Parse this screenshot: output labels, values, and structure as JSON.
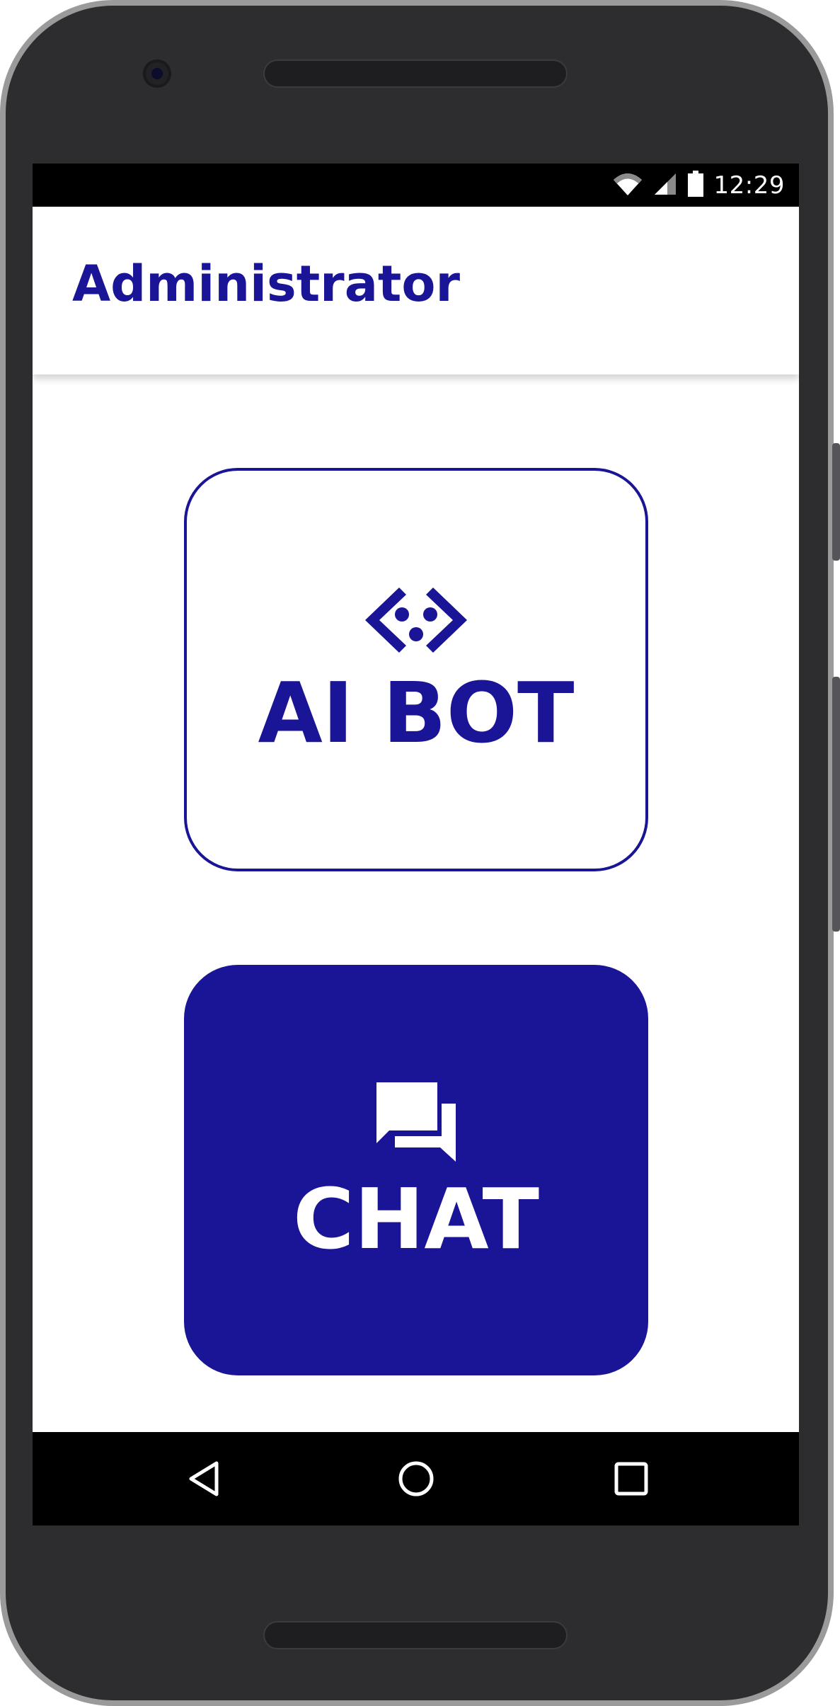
{
  "status_bar": {
    "time": "12:29",
    "icons": [
      "wifi-icon",
      "signal-icon",
      "battery-icon"
    ]
  },
  "app_bar": {
    "title": "Administrator"
  },
  "tiles": [
    {
      "label": "AI BOT",
      "icon": "ai-bot-icon",
      "style": "outline"
    },
    {
      "label": "CHAT",
      "icon": "chat-bubbles-icon",
      "style": "filled"
    }
  ],
  "nav_bar": {
    "icons": [
      "back-icon",
      "home-icon",
      "recent-apps-icon"
    ]
  },
  "colors": {
    "accent": "#1a1496",
    "frame": "#2d2c2f",
    "status_bar": "#000000",
    "background": "#ffffff"
  }
}
